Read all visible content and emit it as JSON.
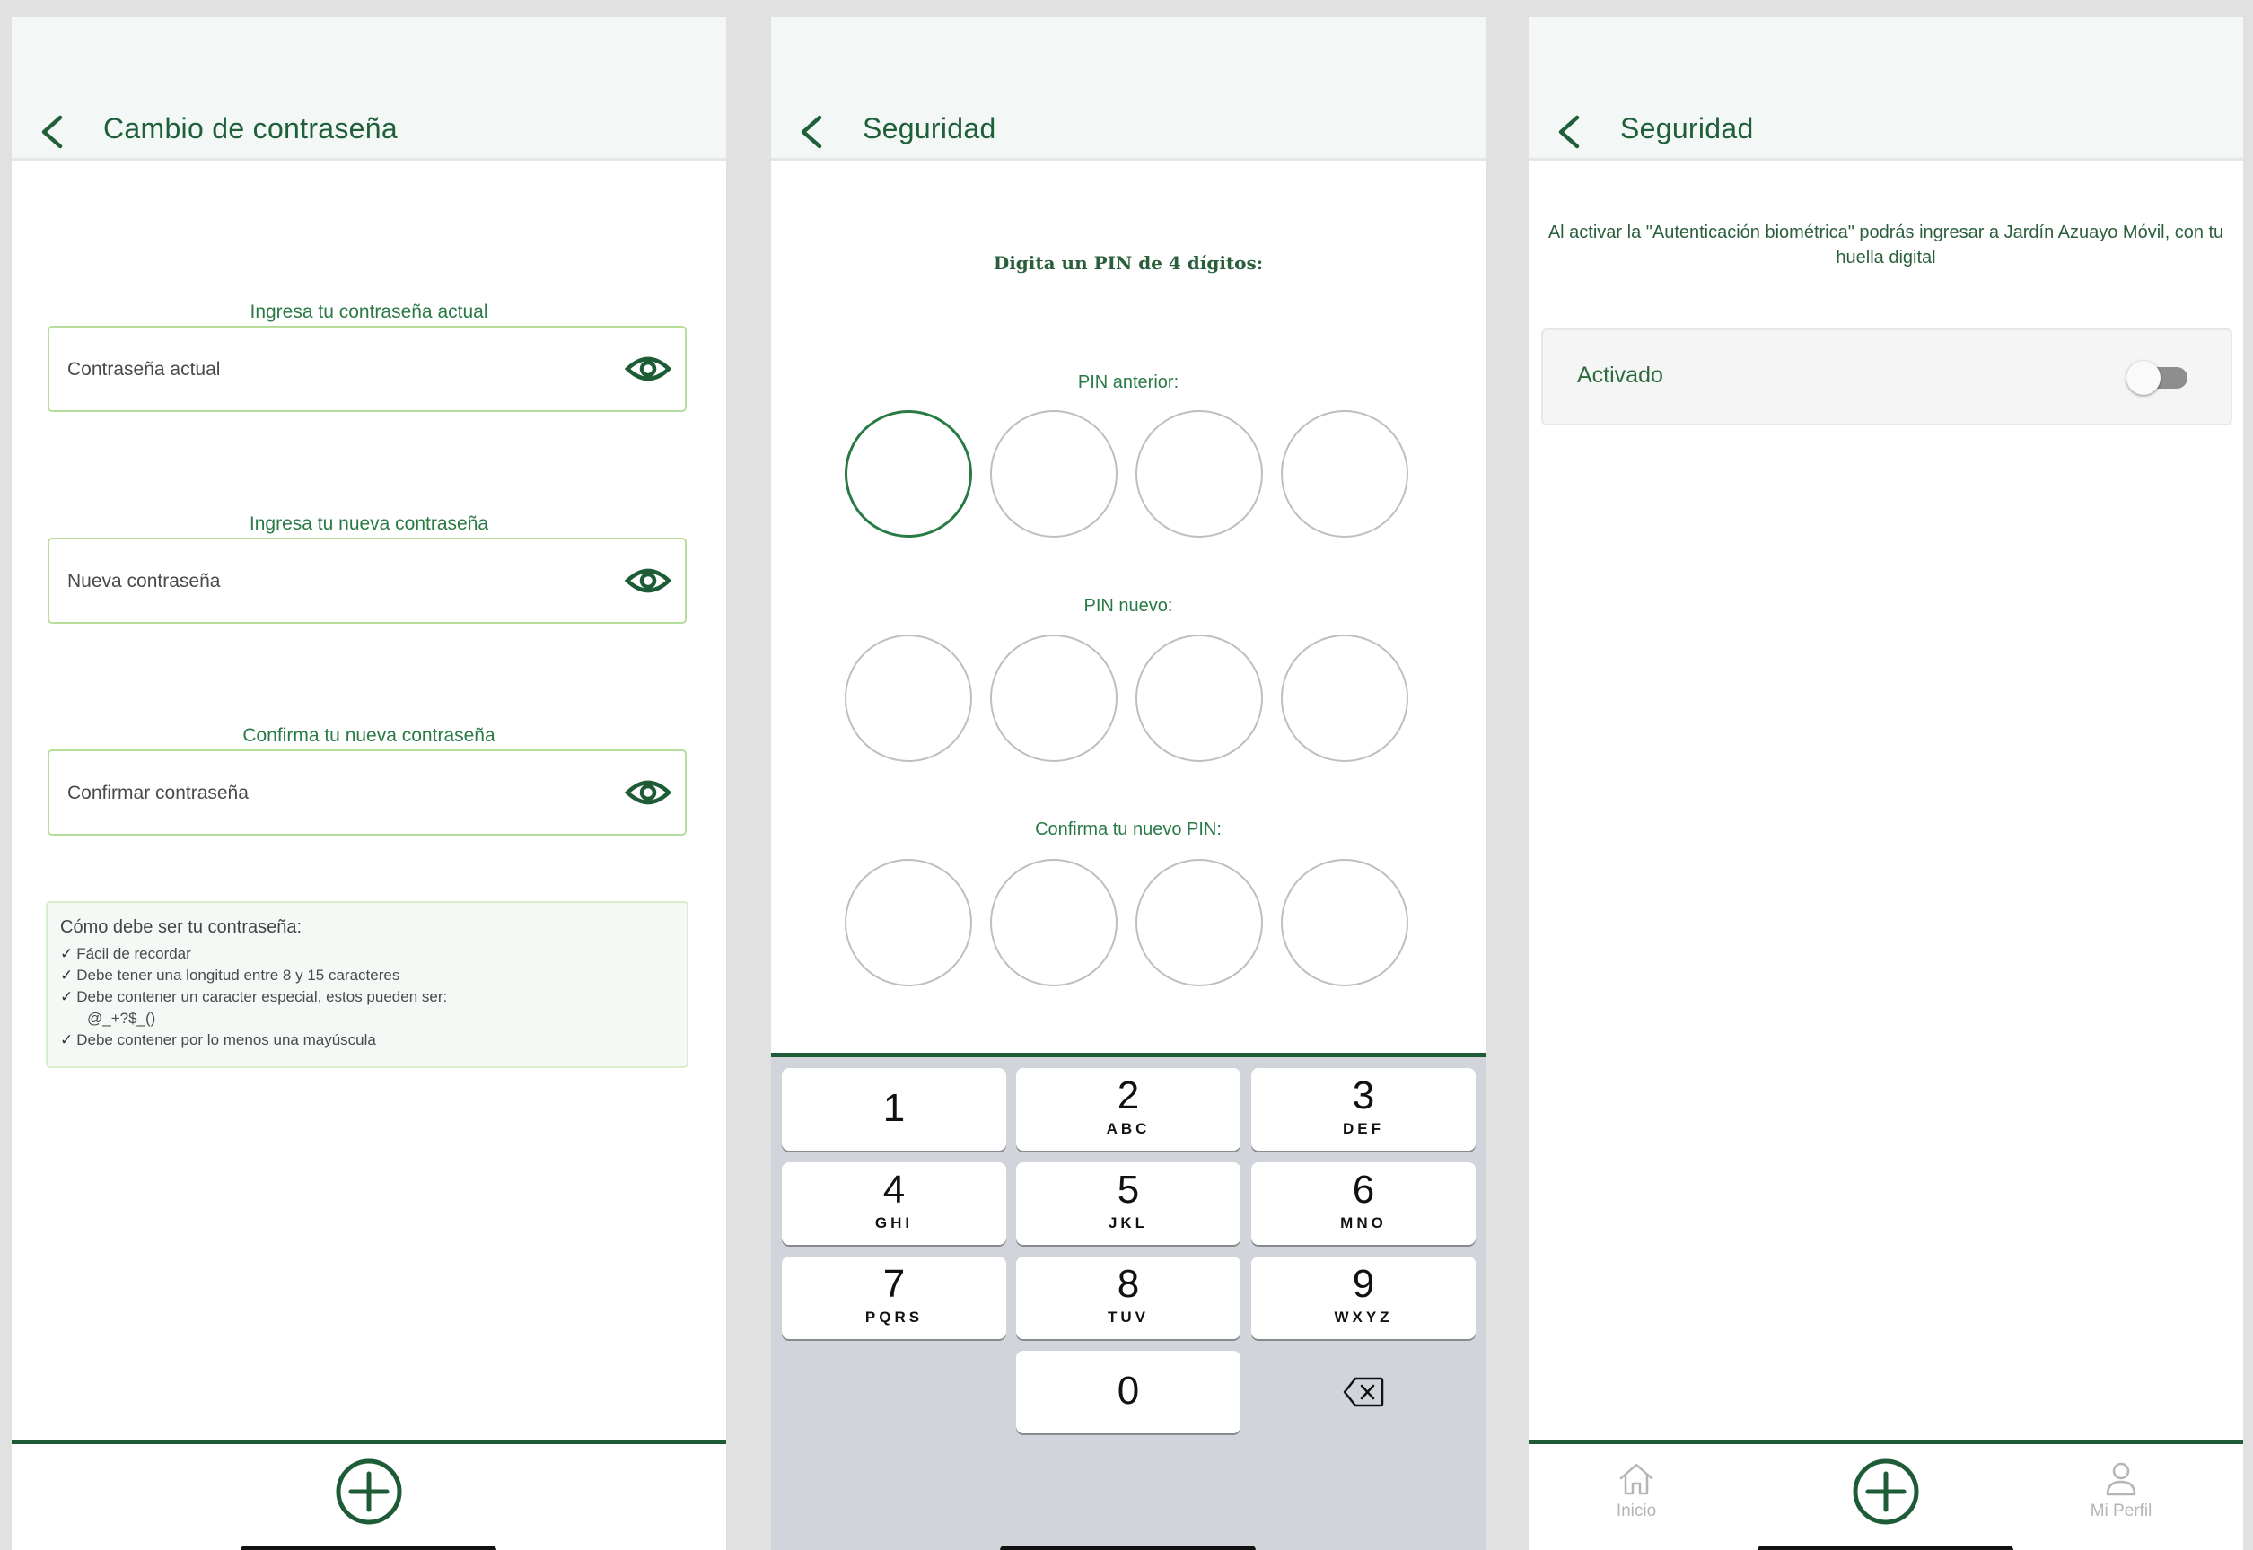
{
  "screen_password": {
    "title": "Cambio de contraseña",
    "fields": [
      {
        "label": "Ingresa tu contraseña actual",
        "placeholder": "Contraseña actual"
      },
      {
        "label": "Ingresa tu nueva contraseña",
        "placeholder": "Nueva contraseña"
      },
      {
        "label": "Confirma tu nueva contraseña",
        "placeholder": "Confirmar contraseña"
      }
    ],
    "rules_title": "Cómo debe ser tu contraseña:",
    "rules": [
      "Fácil de recordar",
      "Debe tener una longitud entre 8 y 15 caracteres",
      "Debe contener un caracter especial, estos pueden ser:",
      "@_+?$_()",
      "Debe contener por lo menos una mayúscula"
    ],
    "check_mark": "✓"
  },
  "screen_pin": {
    "title": "Seguridad",
    "heading": "Digita un PIN de 4 dígitos:",
    "labels": [
      "PIN anterior:",
      "PIN nuevo:",
      "Confirma tu nuevo PIN:"
    ],
    "keyboard": [
      {
        "num": "1",
        "letters": ""
      },
      {
        "num": "2",
        "letters": "ABC"
      },
      {
        "num": "3",
        "letters": "DEF"
      },
      {
        "num": "4",
        "letters": "GHI"
      },
      {
        "num": "5",
        "letters": "JKL"
      },
      {
        "num": "6",
        "letters": "MNO"
      },
      {
        "num": "7",
        "letters": "PQRS"
      },
      {
        "num": "8",
        "letters": "TUV"
      },
      {
        "num": "9",
        "letters": "WXYZ"
      },
      {
        "num": "0",
        "letters": ""
      }
    ]
  },
  "screen_biometric": {
    "title": "Seguridad",
    "description": "Al activar la \"Autenticación biométrica\" podrás ingresar a Jardín Azuayo Móvil, con tu huella digital",
    "toggle_label": "Activado",
    "toggle_on": false,
    "nav": {
      "home": "Inicio",
      "profile": "Mi Perfil"
    }
  },
  "colors": {
    "brand_green": "#1d5c36",
    "accent_green": "#2a7a45",
    "field_border": "#b7dd9a",
    "header_bg": "#f3f8f6",
    "keyboard_bg": "#d1d4da"
  }
}
